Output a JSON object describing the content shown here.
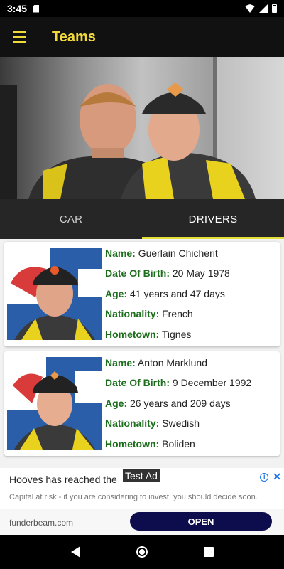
{
  "status_bar": {
    "time": "3:45"
  },
  "app_bar": {
    "title": "Teams",
    "menu_icon": "hamburger-menu-icon"
  },
  "tabs": [
    {
      "label": "CAR",
      "active": false
    },
    {
      "label": "DRIVERS",
      "active": true
    }
  ],
  "labels": {
    "name": "Name:",
    "dob": "Date Of Birth:",
    "age": "Age:",
    "nationality": "Nationality:",
    "hometown": "Hometown:"
  },
  "drivers": [
    {
      "name": "Guerlain Chicherit",
      "dob": "20 May 1978",
      "age": "41 years and 47 days",
      "nationality": "French",
      "hometown": "Tignes"
    },
    {
      "name": "Anton Marklund",
      "dob": "9 December 1992",
      "age": "26 years and 209 days",
      "nationality": "Swedish",
      "hometown": "Boliden"
    }
  ],
  "ad": {
    "badge": "Test Ad",
    "headline": "Hooves has reached the",
    "body": "Capital at risk - if you are considering to invest, you should decide soon.",
    "domain": "funderbeam.com",
    "cta": "OPEN"
  },
  "colors": {
    "accent_yellow": "#f2d93a",
    "label_green": "#1c6e1c",
    "app_bar_bg": "#111111",
    "tab_bg": "#262626",
    "cta_navy": "#0d0d4d"
  }
}
